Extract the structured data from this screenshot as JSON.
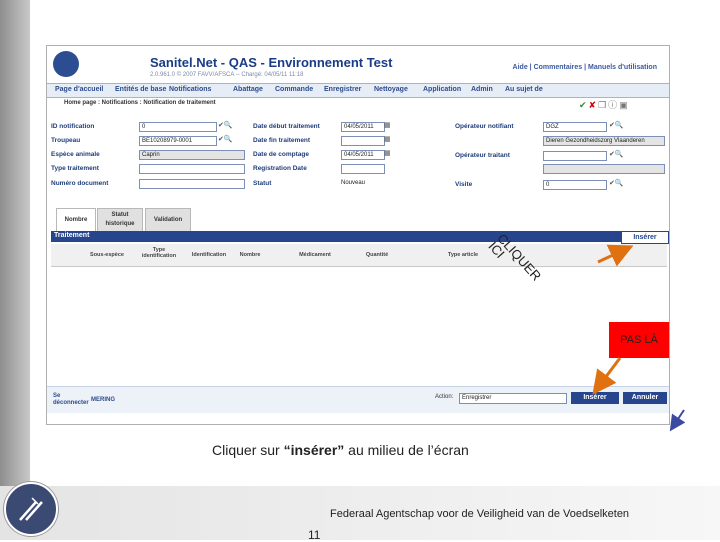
{
  "app": {
    "title": "Sanitel.Net - QAS - Environnement Test",
    "subtitle": "2.0.961.0 © 2007 FAVV/AFSCA -- Chargé: 04/05/11 11:18",
    "help_links": "Aide | Commentaires | Manuels d'utilisation"
  },
  "menu": [
    "Page d'accueil",
    "Entités de base",
    "Notifications",
    "Abattage",
    "Commande",
    "Enregistrer",
    "Nettoyage",
    "Application",
    "Admin",
    "Au sujet de"
  ],
  "breadcrumb": "Home page : Notifications : Notification de traitement",
  "form": {
    "id_notification": {
      "label": "ID notification",
      "value": "0"
    },
    "troupeau": {
      "label": "Troupeau",
      "value": "BE10208979-0001"
    },
    "espece_animale": {
      "label": "Espèce animale",
      "value": "Caprin"
    },
    "type_traitement": {
      "label": "Type traitement",
      "value": ""
    },
    "numero_document": {
      "label": "Numéro document",
      "value": ""
    },
    "date_debut": {
      "label": "Date début traitement",
      "value": "04/05/2011"
    },
    "date_fin": {
      "label": "Date fin traitement",
      "value": ""
    },
    "date_comptage": {
      "label": "Date de comptage",
      "value": "04/05/2011"
    },
    "registration_date": {
      "label": "Registration Date",
      "value": ""
    },
    "statut": {
      "label": "Statut",
      "value": "Nouveau"
    },
    "operateur_notifiant": {
      "label": "Opérateur notifiant",
      "value": "DGZ"
    },
    "operateur_notifiant_name": "Dieren Gezondheidszorg Vlaanderen",
    "operateur_traitant": {
      "label": "Opérateur traitant",
      "value": ""
    },
    "visite": {
      "label": "Visite",
      "value": "0"
    }
  },
  "tabs": [
    "Nombre",
    "Statut historique",
    "Validation"
  ],
  "table": {
    "title": "Traitement",
    "insert_label": "Insérer",
    "columns": [
      "Sous-espèce",
      "Type identification",
      "Identification",
      "Nombre",
      "Médicament",
      "Quantité",
      "Type article"
    ]
  },
  "bottom": {
    "disconnect": "Se déconnecter",
    "user": "MERING",
    "action_label": "Action:",
    "action_value": "Enregistrer",
    "btn_inserer": "Insérer",
    "btn_annuler": "Annuler"
  },
  "annotations": {
    "clique": "CLIQUER ICI",
    "pas_la": "PAS LÀ",
    "caption_prefix": "Cliquer sur ",
    "caption_bold": "“insérer”",
    "caption_suffix": " au milieu de l’écran"
  },
  "footer": {
    "agency": "Federaal Agentschap voor de Veiligheid van de Voedselketen",
    "page": "11"
  },
  "colors": {
    "primary": "#26458c",
    "accent_red": "#ff0000",
    "arrow": "#e07010"
  }
}
